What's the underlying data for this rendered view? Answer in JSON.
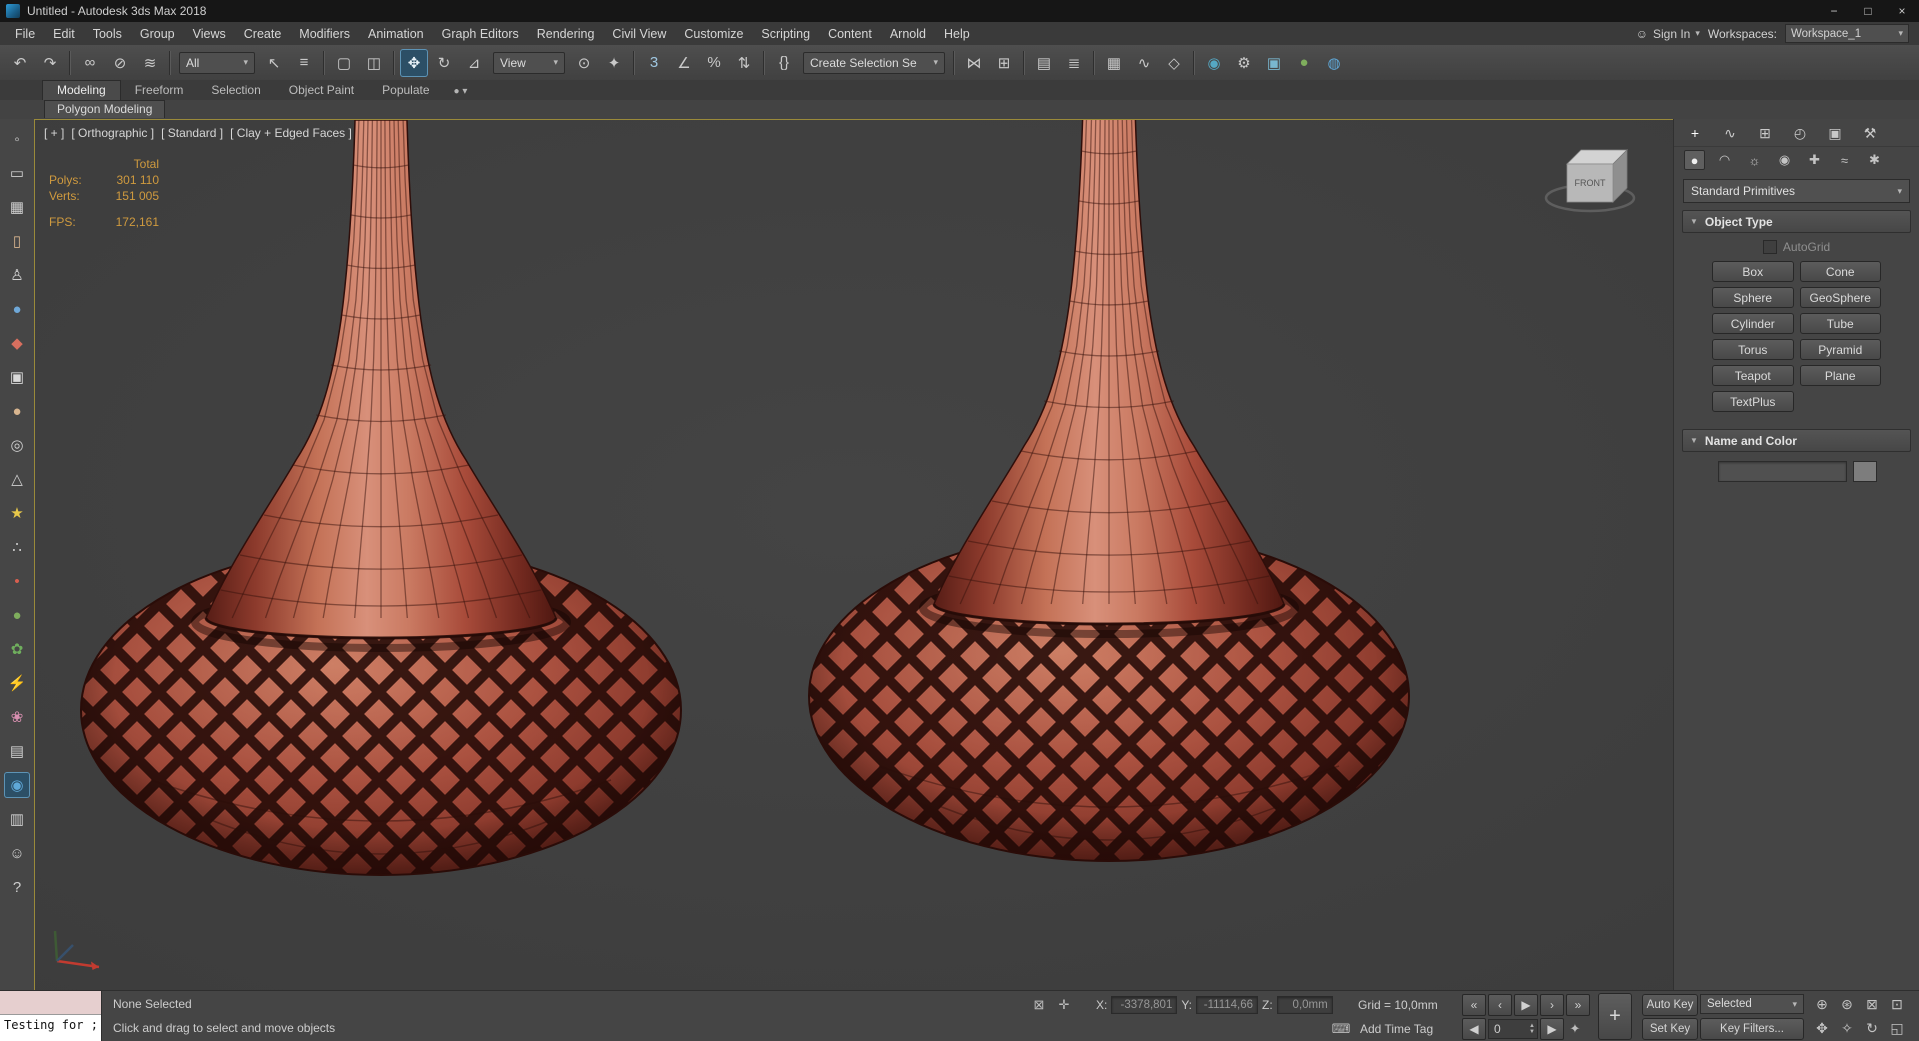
{
  "window": {
    "title": "Untitled - Autodesk 3ds Max 2018",
    "minimize": "−",
    "restore": "□",
    "close": "×"
  },
  "menubar": {
    "items": [
      "File",
      "Edit",
      "Tools",
      "Group",
      "Views",
      "Create",
      "Modifiers",
      "Animation",
      "Graph Editors",
      "Rendering",
      "Civil View",
      "Customize",
      "Scripting",
      "Content",
      "Arnold",
      "Help"
    ],
    "sign_in": "Sign In",
    "person_glyph": "☺",
    "caret": "▾",
    "workspaces_label": "Workspaces:",
    "workspace_value": "Workspace_1"
  },
  "toolbar": {
    "filter_value": "All",
    "coord_value": "View",
    "selection_set_value": "Create Selection Se",
    "caret": "▾",
    "groups": {
      "a": [
        {
          "name": "undo-icon",
          "glyph": "↶"
        },
        {
          "name": "redo-icon",
          "glyph": "↷"
        },
        {
          "kind": "sep",
          "name": "separator"
        },
        {
          "name": "select-and-link-icon",
          "glyph": "∞"
        },
        {
          "name": "unlink-selection-icon",
          "glyph": "⊘"
        },
        {
          "name": "bind-to-space-warp-icon",
          "glyph": "≋"
        },
        {
          "kind": "sep",
          "name": "separator"
        }
      ],
      "b": [
        {
          "name": "select-object-icon",
          "glyph": "↖"
        },
        {
          "name": "select-by-name-icon",
          "glyph": "≡"
        },
        {
          "kind": "sep",
          "name": "separator"
        },
        {
          "name": "rectangular-selection-region-icon",
          "glyph": "▢"
        },
        {
          "name": "window-crossing-icon",
          "glyph": "◫"
        },
        {
          "kind": "sep",
          "name": "separator"
        },
        {
          "name": "select-and-move-icon",
          "glyph": "✥",
          "active": true
        },
        {
          "name": "select-and-rotate-icon",
          "glyph": "↻"
        },
        {
          "name": "select-and-scale-icon",
          "glyph": "⊿"
        }
      ],
      "c": [
        {
          "name": "use-pivot-center-icon",
          "glyph": "⊙"
        },
        {
          "name": "select-and-manipulate-icon",
          "glyph": "✦"
        },
        {
          "kind": "sep",
          "name": "separator"
        },
        {
          "name": "snaps-toggle-icon",
          "glyph": "3",
          "color": "#9fc6e0"
        },
        {
          "name": "angle-snap-icon",
          "glyph": "∠"
        },
        {
          "name": "percent-snap-icon",
          "glyph": "%"
        },
        {
          "name": "spinner-snap-icon",
          "glyph": "⇅"
        },
        {
          "kind": "sep",
          "name": "separator"
        },
        {
          "name": "edit-named-selection-sets-icon",
          "glyph": "{}"
        }
      ],
      "d": [
        {
          "kind": "sep",
          "name": "separator"
        },
        {
          "name": "mirror-icon",
          "glyph": "⋈"
        },
        {
          "name": "align-icon",
          "glyph": "⊞"
        },
        {
          "kind": "sep",
          "name": "separator"
        },
        {
          "name": "toggle-scene-explorer-icon",
          "glyph": "▤"
        },
        {
          "name": "toggle-layer-explorer-icon",
          "glyph": "≣"
        },
        {
          "kind": "sep",
          "name": "separator"
        },
        {
          "name": "toggle-ribbon-icon",
          "glyph": "▦"
        },
        {
          "name": "curve-editor-icon",
          "glyph": "∿"
        },
        {
          "name": "schematic-view-icon",
          "glyph": "◇"
        },
        {
          "kind": "sep",
          "name": "separator"
        },
        {
          "name": "material-editor-icon",
          "glyph": "◉",
          "color": "#55a8c4"
        },
        {
          "name": "render-setup-icon",
          "glyph": "⚙"
        },
        {
          "name": "rendered-frame-window-icon",
          "glyph": "▣",
          "color": "#79b7cf"
        },
        {
          "name": "render-production-icon",
          "glyph": "●",
          "color": "#7fae5d"
        },
        {
          "name": "render-iterative-icon",
          "glyph": "◍",
          "color": "#5fa8d8"
        }
      ]
    }
  },
  "ribbon": {
    "tabs": [
      {
        "label": "Modeling",
        "active": true
      },
      {
        "label": "Freeform"
      },
      {
        "label": "Selection"
      },
      {
        "label": "Object Paint"
      },
      {
        "label": "Populate"
      }
    ],
    "overflow_glyph": "●  ▾",
    "panel_chip": "Polygon Modeling"
  },
  "left_toolbar": {
    "icons": [
      {
        "name": "point-helper-icon",
        "glyph": "◦",
        "color": "#cfcfcf"
      },
      {
        "name": "rectangle-shape-icon",
        "glyph": "▭",
        "color": "#cfcfcf"
      },
      {
        "name": "grid-helper-icon",
        "glyph": "▦",
        "color": "#cfcfcf"
      },
      {
        "name": "cylinder-primitive-icon",
        "glyph": "▯",
        "color": "#d8b58f"
      },
      {
        "name": "biped-icon",
        "glyph": "♙",
        "color": "#cfcfcf"
      },
      {
        "name": "sphere-primitive-icon",
        "glyph": "●",
        "color": "#6fa8d8"
      },
      {
        "name": "marker-icon",
        "glyph": "◆",
        "color": "#d86f5f"
      },
      {
        "name": "box-primitive-icon",
        "glyph": "▣",
        "color": "#d8d8d8"
      },
      {
        "name": "geosphere-primitive-icon",
        "glyph": "●",
        "color": "#d8b58f"
      },
      {
        "name": "torus-primitive-icon",
        "glyph": "◎",
        "color": "#cfcfcf"
      },
      {
        "name": "cone-primitive-icon",
        "glyph": "△",
        "color": "#cfcfcf"
      },
      {
        "name": "star-shape-icon",
        "glyph": "★",
        "color": "#e8c84a"
      },
      {
        "name": "scatter-icon",
        "glyph": "∴",
        "color": "#cfcfcf"
      },
      {
        "name": "point-icon",
        "glyph": "•",
        "color": "#d85f4f"
      },
      {
        "name": "sphere-green-icon",
        "glyph": "●",
        "color": "#7fae5d"
      },
      {
        "name": "foliage-icon",
        "glyph": "✿",
        "color": "#6fae5d"
      },
      {
        "name": "lightning-icon",
        "glyph": "⚡",
        "color": "#e8c84a"
      },
      {
        "name": "flower-icon",
        "glyph": "❀",
        "color": "#d88fb0"
      },
      {
        "name": "clipboard-icon",
        "glyph": "▤",
        "color": "#cfcfcf"
      },
      {
        "name": "active-tool-icon",
        "glyph": "◉",
        "color": "#5fa8d8",
        "active": true
      },
      {
        "name": "clipboard-alt-icon",
        "glyph": "▥",
        "color": "#cfcfcf"
      },
      {
        "name": "character-icon",
        "glyph": "☺",
        "color": "#cfcfcf"
      },
      {
        "name": "help-icon",
        "glyph": "?",
        "color": "#cfcfcf"
      }
    ]
  },
  "viewport": {
    "label_segments": [
      "[ + ]",
      "[ Orthographic ]",
      "[ Standard ]",
      "[ Clay + Edged Faces ]"
    ],
    "stats": {
      "total_label": "Total",
      "polys_label": "Polys:",
      "polys_value": "301 110",
      "verts_label": "Verts:",
      "verts_value": "151 005",
      "fps_label": "FPS:",
      "fps_value": "172,161"
    },
    "viewcube_label": "FRONT"
  },
  "command_panel": {
    "tabs": [
      {
        "name": "create-tab-icon",
        "glyph": "+",
        "active": true
      },
      {
        "name": "modify-tab-icon",
        "glyph": "∿"
      },
      {
        "name": "hierarchy-tab-icon",
        "glyph": "⊞"
      },
      {
        "name": "motion-tab-icon",
        "glyph": "◴"
      },
      {
        "name": "display-tab-icon",
        "glyph": "▣"
      },
      {
        "name": "utilities-tab-icon",
        "glyph": "⚒"
      }
    ],
    "categories": [
      {
        "name": "geometry-category-icon",
        "glyph": "●",
        "active": true
      },
      {
        "name": "shapes-category-icon",
        "glyph": "◠"
      },
      {
        "name": "lights-category-icon",
        "glyph": "☼"
      },
      {
        "name": "cameras-category-icon",
        "glyph": "◉"
      },
      {
        "name": "helpers-category-icon",
        "glyph": "✚"
      },
      {
        "name": "space-warps-category-icon",
        "glyph": "≈"
      },
      {
        "name": "systems-category-icon",
        "glyph": "✱"
      }
    ],
    "caret": "▾",
    "rollout_arrow": "▼",
    "primitives_dropdown": "Standard Primitives",
    "object_type_header": "Object Type",
    "autogrid_label": "AutoGrid",
    "object_buttons": [
      "Box",
      "Cone",
      "Sphere",
      "GeoSphere",
      "Cylinder",
      "Tube",
      "Torus",
      "Pyramid",
      "Teapot",
      "Plane",
      "TextPlus"
    ],
    "name_color_header": "Name and Color",
    "name_value": ""
  },
  "statusbar": {
    "listener_macro_text": "",
    "listener_text": "Testing for ;",
    "selection_status": "None Selected",
    "prompt": "Click and drag to select and move objects",
    "lock_icons": [
      {
        "name": "selection-lock-icon",
        "glyph": "⊠"
      },
      {
        "name": "transform-type-in-icon",
        "glyph": "✛"
      }
    ],
    "x_label": "X:",
    "x_value": "-3378,801",
    "y_label": "Y:",
    "y_value": "-11114,66",
    "z_label": "Z:",
    "z_value": "0,0mm",
    "grid_label": "Grid = 10,0mm",
    "keyboard_override_glyph": "⌨",
    "time_tag_label": "Add Time Tag",
    "transport": [
      {
        "name": "go-to-start-button",
        "glyph": "«"
      },
      {
        "name": "previous-frame-button",
        "glyph": "‹"
      },
      {
        "name": "play-button",
        "glyph": "▶"
      },
      {
        "name": "next-frame-button",
        "glyph": "›"
      },
      {
        "name": "go-to-end-button",
        "glyph": "»"
      }
    ],
    "frame_prev_glyph": "◀",
    "frame_value": "0",
    "spinner_up": "▲",
    "spinner_down": "▼",
    "frame_next_glyph": "▶",
    "key_mode_glyph": "✦",
    "set_keys_glyph": "+",
    "auto_key_label": "Auto Key",
    "selected_value": "Selected",
    "set_key_label": "Set Key",
    "key_filters_label": "Key Filters...",
    "nav_icons": [
      {
        "name": "zoom-icon",
        "glyph": "⊕"
      },
      {
        "name": "zoom-all-icon",
        "glyph": "⊛"
      },
      {
        "name": "zoom-extents-icon",
        "glyph": "⊠"
      },
      {
        "name": "zoom-region-icon",
        "glyph": "⊡"
      },
      {
        "name": "pan-icon",
        "glyph": "✥"
      },
      {
        "name": "walk-through-icon",
        "glyph": "✧"
      },
      {
        "name": "orbit-icon",
        "glyph": "↻"
      },
      {
        "name": "maximize-viewport-icon",
        "glyph": "◱"
      }
    ]
  },
  "colors": {
    "clay": "#b05442",
    "viewport_bg": "#404040",
    "ui_bg": "#454545",
    "accent": "#5d93b5",
    "stats_text": "#cf9a3f",
    "active_viewport_border": "#9a8a3a"
  }
}
